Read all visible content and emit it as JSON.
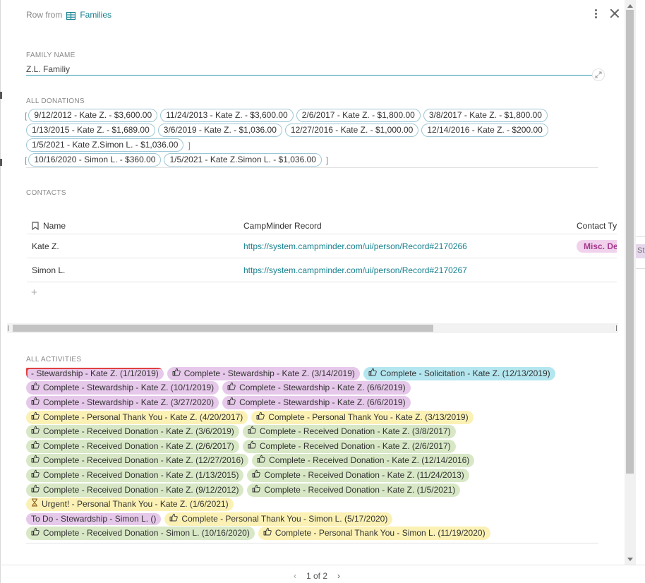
{
  "header": {
    "prefix": "Row from",
    "table_name": "Families"
  },
  "fields": {
    "family_name_label": "FAMILY NAME",
    "family_name_value": "Z.L. Familiy",
    "donations_label": "ALL DONATIONS",
    "contacts_label": "CONTACTS",
    "activities_label": "ALL ACTIVITIES"
  },
  "donations": {
    "row1": [
      "9/12/2012 - Kate Z. - $3,600.00",
      "11/24/2013 - Kate Z. - $3,600.00",
      "2/6/2017 - Kate Z. - $1,800.00",
      "3/8/2017 - Kate Z. - $1,800.00"
    ],
    "row2": [
      "1/13/2015 - Kate Z. - $1,689.00",
      "3/6/2019 - Kate Z. - $1,036.00",
      "12/27/2016 - Kate Z. - $1,000.00",
      "12/14/2016 - Kate Z. - $200.00"
    ],
    "row3": [
      "1/5/2021 - Kate Z.Simon L. - $1,036.00"
    ],
    "row4": [
      "10/16/2020 - Simon L. - $360.00",
      "1/5/2021 - Kate Z.Simon L. - $1,036.00"
    ]
  },
  "contacts": {
    "columns": [
      "Name",
      "CampMinder Record",
      "Contact Ty"
    ],
    "rows": [
      {
        "name": "Kate Z.",
        "record": "https://system.campminder.com/ui/person/Record#2170266",
        "type": "Misc. De"
      },
      {
        "name": "Simon L.",
        "record": "https://system.campminder.com/ui/person/Record#2170267",
        "type": ""
      }
    ],
    "add_label": "+"
  },
  "activity_colors": {
    "purple": "#e6c8ea",
    "cyan": "#b4e6ef",
    "yellow": "#fbf1b4",
    "green": "#d8e8c6"
  },
  "activities": [
    [
      {
        "text": "- Stewardship - Kate Z. (1/1/2019)",
        "color": "purple",
        "icon": "",
        "flag": true
      },
      {
        "text": "Complete - Stewardship - Kate Z. (3/14/2019)",
        "color": "purple",
        "icon": "thumbs-up-icon"
      },
      {
        "text": "Complete - Solicitation - Kate Z. (12/13/2019)",
        "color": "cyan",
        "icon": "thumbs-up-icon"
      }
    ],
    [
      {
        "text": "Complete - Stewardship - Kate Z. (10/1/2019)",
        "color": "purple",
        "icon": "thumbs-up-icon"
      },
      {
        "text": "Complete - Stewardship - Kate Z. (6/6/2019)",
        "color": "purple",
        "icon": "thumbs-up-icon"
      }
    ],
    [
      {
        "text": "Complete - Stewardship - Kate Z. (3/27/2020)",
        "color": "purple",
        "icon": "thumbs-up-icon"
      },
      {
        "text": "Complete - Stewardship - Kate Z. (6/6/2019)",
        "color": "purple",
        "icon": "thumbs-up-icon"
      }
    ],
    [
      {
        "text": "Complete - Personal Thank You - Kate Z. (4/20/2017)",
        "color": "yellow",
        "icon": "thumbs-up-icon"
      },
      {
        "text": "Complete - Personal Thank You - Kate Z. (3/13/2019)",
        "color": "yellow",
        "icon": "thumbs-up-icon"
      }
    ],
    [
      {
        "text": "Complete - Received Donation - Kate Z. (3/6/2019)",
        "color": "green",
        "icon": "thumbs-up-icon"
      },
      {
        "text": "Complete - Received Donation - Kate Z. (3/8/2017)",
        "color": "green",
        "icon": "thumbs-up-icon"
      }
    ],
    [
      {
        "text": "Complete - Received Donation - Kate Z. (2/6/2017)",
        "color": "green",
        "icon": "thumbs-up-icon"
      },
      {
        "text": "Complete - Received Donation - Kate Z. (2/6/2017)",
        "color": "green",
        "icon": "thumbs-up-icon"
      }
    ],
    [
      {
        "text": "Complete - Received Donation - Kate Z. (12/27/2016)",
        "color": "green",
        "icon": "thumbs-up-icon"
      },
      {
        "text": "Complete - Received Donation - Kate Z. (12/14/2016)",
        "color": "green",
        "icon": "thumbs-up-icon"
      }
    ],
    [
      {
        "text": "Complete - Received Donation - Kate Z. (1/13/2015)",
        "color": "green",
        "icon": "thumbs-up-icon"
      },
      {
        "text": "Complete - Received Donation - Kate Z. (11/24/2013)",
        "color": "green",
        "icon": "thumbs-up-icon"
      }
    ],
    [
      {
        "text": "Complete - Received Donation - Kate Z. (9/12/2012)",
        "color": "green",
        "icon": "thumbs-up-icon"
      },
      {
        "text": "Complete - Received Donation - Kate Z. (1/5/2021)",
        "color": "green",
        "icon": "thumbs-up-icon"
      }
    ],
    [
      {
        "text": "Urgent! - Personal Thank You - Kate Z. (1/6/2021)",
        "color": "yellow",
        "icon": "hourglass-icon"
      }
    ],
    [
      {
        "text": "To Do - Stewardship - Simon L. ()",
        "color": "purple",
        "icon": ""
      },
      {
        "text": "Complete - Personal Thank You - Simon L. (5/17/2020)",
        "color": "yellow",
        "icon": "thumbs-up-icon"
      }
    ],
    [
      {
        "text": "Complete - Received Donation - Simon L. (10/16/2020)",
        "color": "green",
        "icon": "thumbs-up-icon"
      },
      {
        "text": "Complete - Personal Thank You - Simon L. (11/19/2020)",
        "color": "yellow",
        "icon": "thumbs-up-icon"
      }
    ]
  ],
  "pager": {
    "text": "1 of 2"
  },
  "background_hint": "St"
}
